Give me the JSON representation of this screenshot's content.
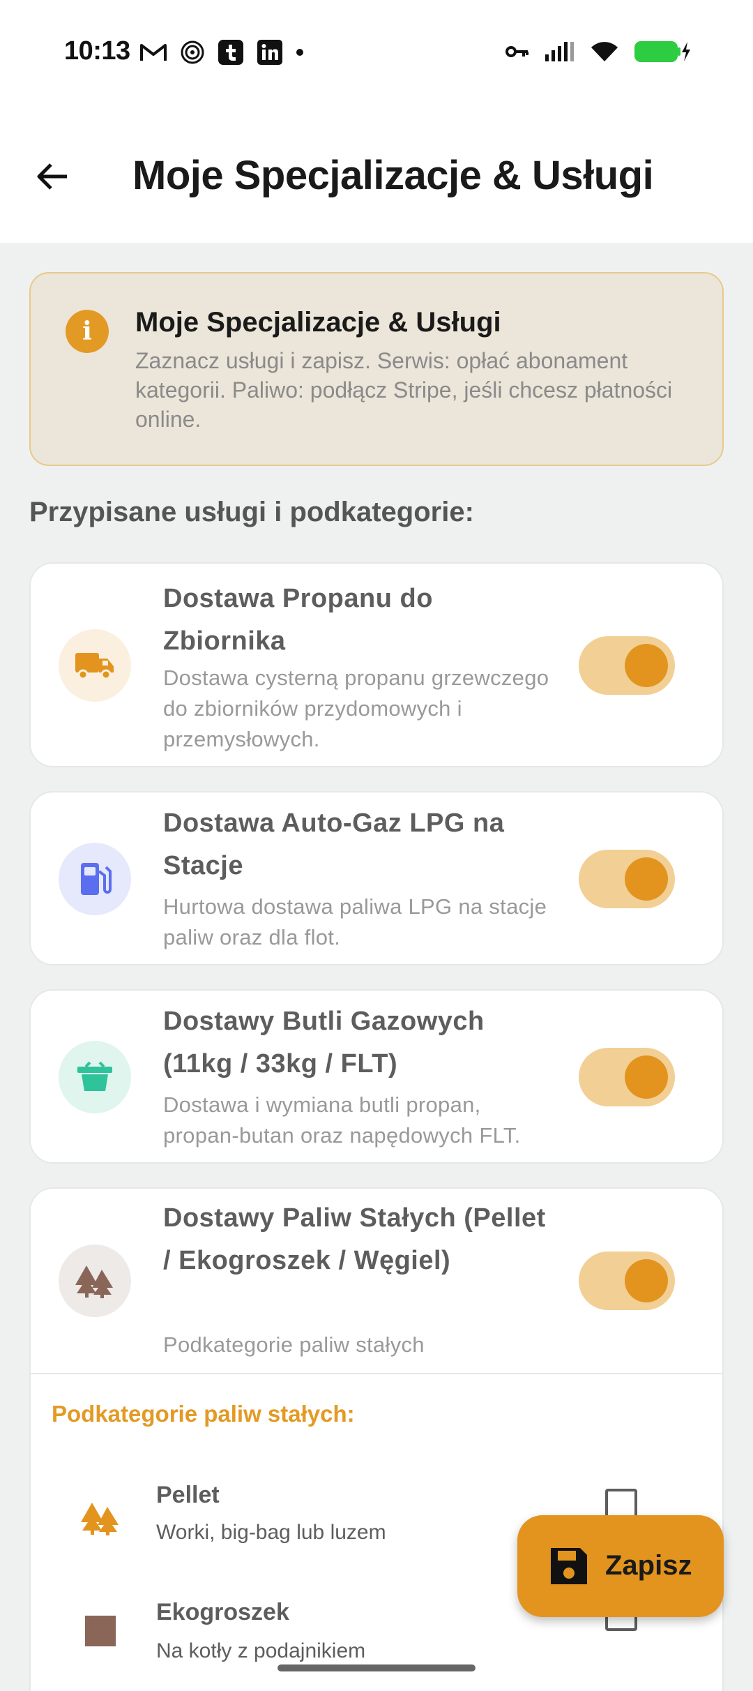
{
  "status_bar": {
    "time": "10:13"
  },
  "header": {
    "title": "Moje Specjalizacje & Usługi"
  },
  "info_banner": {
    "title": "Moje Specjalizacje & Usługi",
    "text": "Zaznacz usługi i zapisz. Serwis: opłać abonament kategorii. Paliwo: podłącz Stripe, jeśli chcesz płatności online."
  },
  "section": {
    "label": "Przypisane usługi i podkategorie:"
  },
  "services": [
    {
      "title": "Dostawa Propanu do Zbiornika",
      "description": "Dostawa cysterną propanu grzewczego do zbiorników przydomowych i przemysłowych.",
      "icon": "truck-icon",
      "enabled": true
    },
    {
      "title": "Dostawa Auto-Gaz LPG na Stacje",
      "description": "Hurtowa dostawa paliwa LPG na stacje paliw oraz dla flot.",
      "icon": "fuel-pump-icon",
      "enabled": true
    },
    {
      "title": "Dostawy Butli Gazowych (11kg / 33kg / FLT)",
      "description": "Dostawa i wymiana butli propan, propan-butan oraz napędowych FLT.",
      "icon": "basket-icon",
      "enabled": true
    },
    {
      "title": "Dostawy Paliw Stałych (Pellet / Ekogroszek / Węgiel)",
      "description": "Podkategorie paliw stałych",
      "icon": "trees-icon",
      "enabled": true
    }
  ],
  "subcategories": {
    "header": "Podkategorie paliw stałych:",
    "items": [
      {
        "title": "Pellet",
        "description": "Worki, big-bag lub luzem",
        "icon": "trees-icon",
        "checked": false
      },
      {
        "title": "Ekogroszek",
        "description": "Na kotły z podajnikiem",
        "icon": "square-icon",
        "checked": false
      }
    ]
  },
  "fab": {
    "label": "Zapisz",
    "icon": "save-icon"
  },
  "colors": {
    "accent": "#e2941f",
    "toggle_track": "#f2cf94",
    "banner_bg": "#ece6da",
    "page_bg": "#eef1f0"
  }
}
